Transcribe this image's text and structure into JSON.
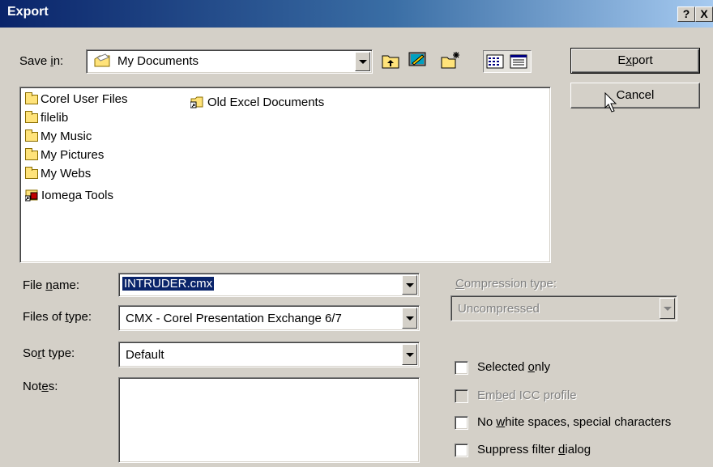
{
  "window": {
    "title": "Export",
    "help_glyph": "?",
    "close_glyph": "X"
  },
  "save_in": {
    "label_pre": "Save ",
    "label_key": "i",
    "label_post": "n:",
    "value": "My Documents"
  },
  "files": [
    {
      "name": "Corel User Files",
      "icon": "folder-icon"
    },
    {
      "name": "filelib",
      "icon": "folder-icon"
    },
    {
      "name": "My Music",
      "icon": "folder-icon"
    },
    {
      "name": "My Pictures",
      "icon": "folder-icon"
    },
    {
      "name": "My Webs",
      "icon": "folder-icon"
    },
    {
      "name": "Iomega Tools",
      "icon": "iomega-shortcut-icon"
    },
    {
      "name": "Old Excel Documents",
      "icon": "folder-shortcut-icon"
    }
  ],
  "buttons": {
    "export": {
      "pre": "E",
      "key": "x",
      "post": "port"
    },
    "cancel": {
      "label": "Cancel"
    }
  },
  "file_name": {
    "label_pre": "File ",
    "label_key": "n",
    "label_post": "ame:",
    "value": "INTRUDER.cmx"
  },
  "files_of_type": {
    "label_pre": "Files of ",
    "label_key": "t",
    "label_post": "ype:",
    "value": "CMX - Corel Presentation Exchange 6/7"
  },
  "sort_type": {
    "label_pre": "So",
    "label_key": "r",
    "label_post": "t type:",
    "value": "Default"
  },
  "notes": {
    "label_pre": "Not",
    "label_key": "e",
    "label_post": "s:",
    "value": ""
  },
  "compression": {
    "label_pre": "",
    "label_key": "C",
    "label_post": "ompression type:",
    "value": "Uncompressed"
  },
  "options": [
    {
      "pre": "Selected ",
      "key": "o",
      "post": "nly",
      "checked": false,
      "enabled": true
    },
    {
      "pre": "Em",
      "key": "b",
      "post": "ed ICC profile",
      "checked": false,
      "enabled": false
    },
    {
      "pre": "No ",
      "key": "w",
      "post": "hite spaces, special characters",
      "checked": false,
      "enabled": true
    },
    {
      "pre": "Suppress filter ",
      "key": "d",
      "post": "ialog",
      "checked": false,
      "enabled": true
    }
  ],
  "colors": {
    "title_start": "#0a246a",
    "title_end": "#a6caf0",
    "face": "#d4d0c8",
    "selection": "#0a246a"
  }
}
